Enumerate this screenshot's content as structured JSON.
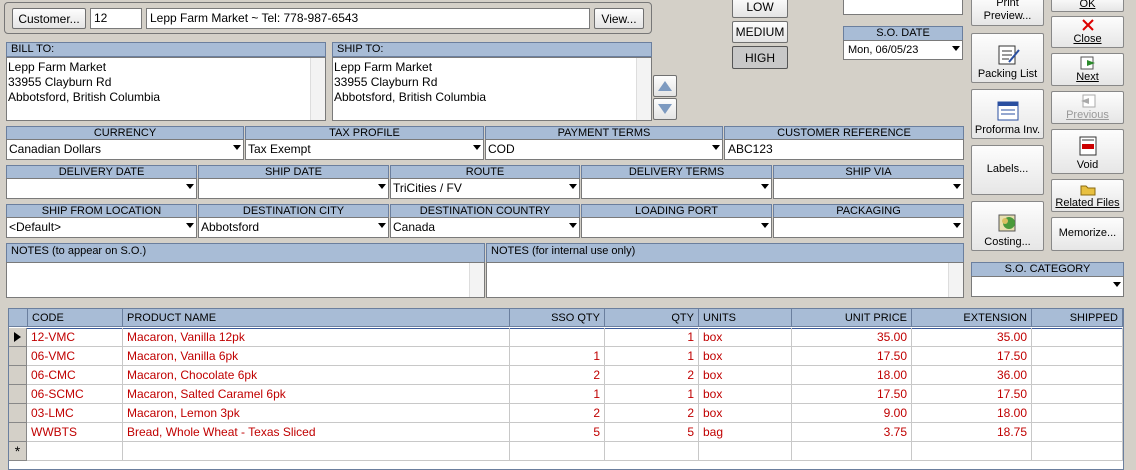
{
  "header": {
    "customer_button": "Customer...",
    "customer_id": "12",
    "customer_info": "Lepp Farm Market  ~  Tel: 778-987-6543",
    "view_button": "View..."
  },
  "priority": {
    "low": "LOW",
    "medium": "MEDIUM",
    "high": "HIGH"
  },
  "so_date": {
    "label": "S.O. DATE",
    "value": "Mon, 06/05/23"
  },
  "bill_to": {
    "label": "BILL TO:",
    "lines": [
      "Lepp Farm Market",
      "33955 Clayburn Rd",
      "Abbotsford, British Columbia"
    ]
  },
  "ship_to": {
    "label": "SHIP TO:",
    "lines": [
      "Lepp Farm Market",
      "33955 Clayburn Rd",
      "Abbotsford, British Columbia"
    ]
  },
  "row1": {
    "currency": {
      "label": "CURRENCY",
      "value": "Canadian Dollars"
    },
    "tax_profile": {
      "label": "TAX PROFILE",
      "value": "Tax Exempt"
    },
    "payment_terms": {
      "label": "PAYMENT TERMS",
      "value": "COD"
    },
    "customer_reference": {
      "label": "CUSTOMER REFERENCE",
      "value": "ABC123"
    }
  },
  "row2": {
    "delivery_date": {
      "label": "DELIVERY DATE",
      "value": ""
    },
    "ship_date": {
      "label": "SHIP DATE",
      "value": ""
    },
    "route": {
      "label": "ROUTE",
      "value": "TriCities / FV"
    },
    "delivery_terms": {
      "label": "DELIVERY TERMS",
      "value": ""
    },
    "ship_via": {
      "label": "SHIP VIA",
      "value": ""
    }
  },
  "row3": {
    "ship_from": {
      "label": "SHIP FROM LOCATION",
      "value": "<Default>"
    },
    "dest_city": {
      "label": "DESTINATION CITY",
      "value": "Abbotsford"
    },
    "dest_country": {
      "label": "DESTINATION COUNTRY",
      "value": "Canada"
    },
    "loading_port": {
      "label": "LOADING PORT",
      "value": ""
    },
    "packaging": {
      "label": "PACKAGING",
      "value": ""
    }
  },
  "notes": {
    "so_label": "NOTES (to appear on S.O.)",
    "internal_label": "NOTES (for internal use only)"
  },
  "side": {
    "print_preview": "Print Preview...",
    "packing_list": "Packing List",
    "proforma": "Proforma Inv.",
    "labels": "Labels...",
    "costing": "Costing...",
    "ok": "OK",
    "close": "Close",
    "next": "Next",
    "previous": "Previous",
    "void": "Void",
    "related_files": "Related Files",
    "memorize": "Memorize...",
    "so_category_label": "S.O. CATEGORY"
  },
  "table": {
    "columns": [
      "CODE",
      "PRODUCT NAME",
      "SSO QTY",
      "QTY",
      "UNITS",
      "UNIT PRICE",
      "EXTENSION",
      "SHIPPED"
    ],
    "rows": [
      [
        "12-VMC",
        "Macaron, Vanilla 12pk",
        "",
        "1",
        "box",
        "35.00",
        "35.00",
        ""
      ],
      [
        "06-VMC",
        "Macaron, Vanilla 6pk",
        "1",
        "1",
        "box",
        "17.50",
        "17.50",
        ""
      ],
      [
        "06-CMC",
        "Macaron, Chocolate 6pk",
        "2",
        "2",
        "box",
        "18.00",
        "36.00",
        ""
      ],
      [
        "06-SCMC",
        "Macaron, Salted Caramel 6pk",
        "1",
        "1",
        "box",
        "17.50",
        "17.50",
        ""
      ],
      [
        "03-LMC",
        "Macaron, Lemon 3pk",
        "2",
        "2",
        "box",
        "9.00",
        "18.00",
        ""
      ],
      [
        "WWBTS",
        "Bread, Whole Wheat - Texas Sliced",
        "5",
        "5",
        "bag",
        "3.75",
        "18.75",
        ""
      ]
    ],
    "new_row_marker": "*"
  }
}
